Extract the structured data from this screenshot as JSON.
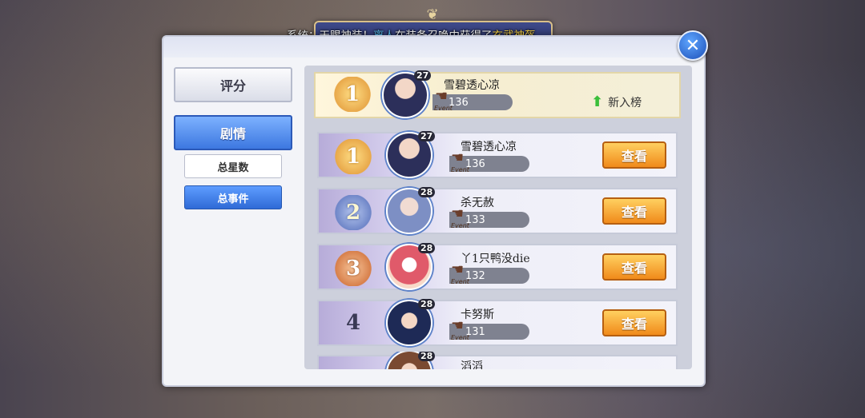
{
  "banner": {
    "prefix": "系统：",
    "part1": "天赐神装！",
    "player": "离人",
    "part2": "在装备召唤中获得了",
    "item": "玄武神盔"
  },
  "close_icon": "✕",
  "side_menu": {
    "score_label": "评分",
    "story_label": "剧情",
    "total_stars_label": "总星数",
    "total_events_label": "总事件"
  },
  "my_rank": {
    "rank": "1",
    "level": "27",
    "name": "雪碧透心凉",
    "event_label": "Event",
    "score": "136",
    "status": "新入榜"
  },
  "rows": [
    {
      "rank": "1",
      "level": "27",
      "name": "雪碧透心凉",
      "event_label": "Event",
      "score": "136",
      "view_label": "查看"
    },
    {
      "rank": "2",
      "level": "28",
      "name": "杀无赦",
      "event_label": "Event",
      "score": "133",
      "view_label": "查看"
    },
    {
      "rank": "3",
      "level": "28",
      "name": "丫1只鸭没die",
      "event_label": "Event",
      "score": "132",
      "view_label": "查看"
    },
    {
      "rank": "4",
      "level": "28",
      "name": "卡努斯",
      "event_label": "Event",
      "score": "131",
      "view_label": "查看"
    },
    {
      "rank": "",
      "level": "28",
      "name": "滔滔",
      "event_label": "",
      "score": "",
      "view_label": ""
    }
  ],
  "colors": {
    "accent_blue": "#3d78e0",
    "view_button": "#f08a1a",
    "highlight_gold": "#ffd84a",
    "highlight_blue": "#5fc8ff"
  }
}
